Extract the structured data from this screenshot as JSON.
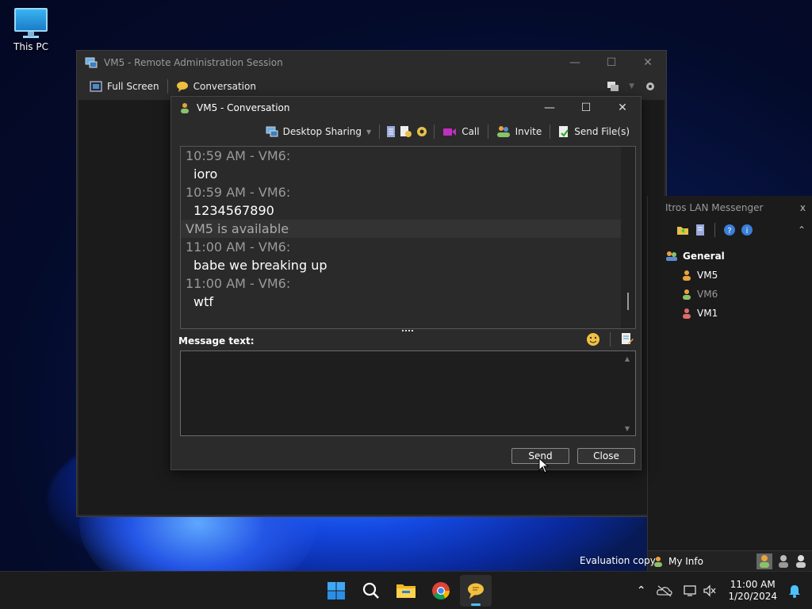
{
  "desktop": {
    "icon_label": "This PC"
  },
  "rdp_window": {
    "title": "VM5 - Remote Administration Session",
    "toolbar": {
      "fullscreen": "Full Screen",
      "conversation": "Conversation"
    }
  },
  "conversation": {
    "title": "VM5 - Conversation",
    "toolbar": {
      "desktop_sharing": "Desktop Sharing",
      "call": "Call",
      "invite": "Invite",
      "send_files": "Send File(s)"
    },
    "history": [
      {
        "type": "meta",
        "text": "10:59 AM - VM6:"
      },
      {
        "type": "msg",
        "text": "ioro"
      },
      {
        "type": "meta",
        "text": "10:59 AM - VM6:"
      },
      {
        "type": "msg",
        "text": "1234567890"
      },
      {
        "type": "status",
        "text": "VM5 is available"
      },
      {
        "type": "meta",
        "text": "11:00 AM - VM6:"
      },
      {
        "type": "msg",
        "text": "babe we breaking up"
      },
      {
        "type": "meta",
        "text": "11:00 AM - VM6:"
      },
      {
        "type": "msg",
        "text": "wtf"
      }
    ],
    "message_label": "Message text:",
    "message_value": "",
    "send_label": "Send",
    "close_label": "Close"
  },
  "messenger": {
    "title": "Itros LAN Messenger",
    "close": "x",
    "group": "General",
    "users": [
      {
        "name": "VM5",
        "status_color": "#e8a33b"
      },
      {
        "name": "VM6",
        "status_color": "#8ac26a"
      },
      {
        "name": "VM1",
        "status_color": "#e06b6b"
      }
    ],
    "my_info": "My Info"
  },
  "watermark": "Evaluation copy",
  "taskbar": {
    "time": "11:00 AM",
    "date": "1/20/2024"
  },
  "colors": {
    "accent": "#4cc2ff",
    "window_bg": "#2b2b2b"
  }
}
